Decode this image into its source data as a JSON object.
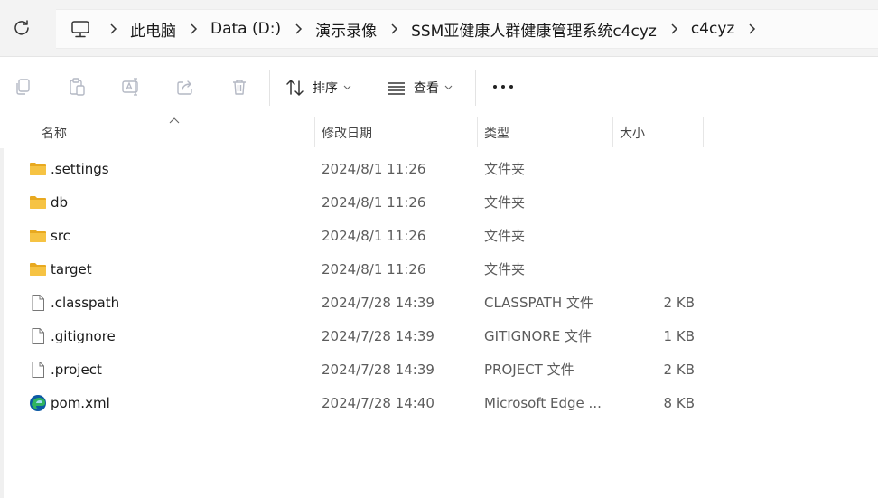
{
  "breadcrumb": {
    "items": [
      "此电脑",
      "Data (D:)",
      "演示录像",
      "SSM亚健康人群健康管理系统c4cyz",
      "c4cyz"
    ]
  },
  "toolbar": {
    "sort_label": "排序",
    "view_label": "查看"
  },
  "columns": {
    "name": "名称",
    "date": "修改日期",
    "type": "类型",
    "size": "大小"
  },
  "files": [
    {
      "name": ".settings",
      "date": "2024/8/1 11:26",
      "type": "文件夹",
      "size": "",
      "icon": "folder-icon"
    },
    {
      "name": "db",
      "date": "2024/8/1 11:26",
      "type": "文件夹",
      "size": "",
      "icon": "folder-icon"
    },
    {
      "name": "src",
      "date": "2024/8/1 11:26",
      "type": "文件夹",
      "size": "",
      "icon": "folder-icon"
    },
    {
      "name": "target",
      "date": "2024/8/1 11:26",
      "type": "文件夹",
      "size": "",
      "icon": "folder-icon"
    },
    {
      "name": ".classpath",
      "date": "2024/7/28 14:39",
      "type": "CLASSPATH 文件",
      "size": "2 KB",
      "icon": "file-icon"
    },
    {
      "name": ".gitignore",
      "date": "2024/7/28 14:39",
      "type": "GITIGNORE 文件",
      "size": "1 KB",
      "icon": "file-icon"
    },
    {
      "name": ".project",
      "date": "2024/7/28 14:39",
      "type": "PROJECT 文件",
      "size": "2 KB",
      "icon": "file-icon"
    },
    {
      "name": "pom.xml",
      "date": "2024/7/28 14:40",
      "type": "Microsoft Edge ...",
      "size": "8 KB",
      "icon": "edge-icon"
    }
  ],
  "colors": {
    "folder": "#f6c343",
    "folder_dark": "#e8a920",
    "edge_blue": "#0c59a4",
    "edge_green": "#2fb35f"
  }
}
